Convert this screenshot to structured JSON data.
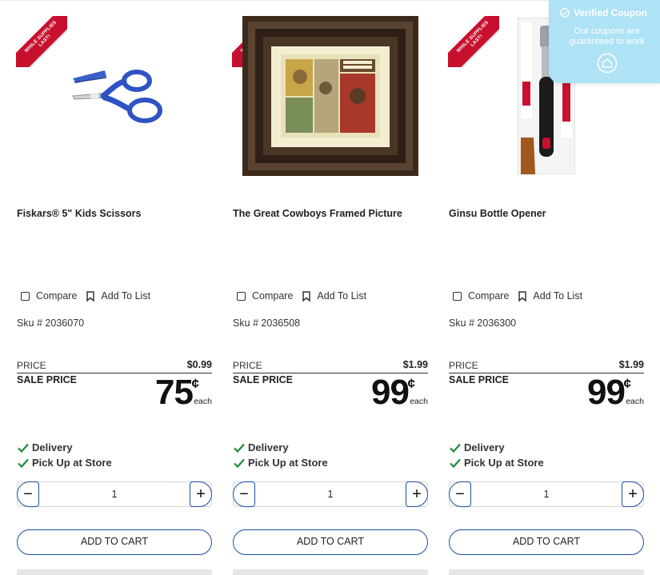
{
  "ribbon": {
    "line1": "WHILE SUPPLIES",
    "line2": "LAST!"
  },
  "products": [
    {
      "name": "Fiskars® 5\" Kids Scissors",
      "sku": "Sku # 2036070",
      "price_label": "PRICE",
      "price": "$0.99",
      "sale_label": "SALE PRICE",
      "sale_amount": "75",
      "sale_unit": "¢",
      "sale_each": "each"
    },
    {
      "name": "The Great Cowboys Framed Picture",
      "sku": "Sku # 2036508",
      "price_label": "PRICE",
      "price": "$1.99",
      "sale_label": "SALE PRICE",
      "sale_amount": "99",
      "sale_unit": "¢",
      "sale_each": "each"
    },
    {
      "name": "Ginsu Bottle Opener",
      "sku": "Sku # 2036300",
      "price_label": "PRICE",
      "price": "$1.99",
      "sale_label": "SALE PRICE",
      "sale_amount": "99",
      "sale_unit": "¢",
      "sale_each": "each"
    }
  ],
  "labels": {
    "compare": "Compare",
    "add_to_list": "Add To List",
    "delivery": "Delivery",
    "pickup": "Pick Up at Store",
    "quantity": "1",
    "minus": "−",
    "plus": "+",
    "add_to_cart": "ADD TO CART"
  },
  "coupon": {
    "title": "Verified Coupon",
    "subtitle_line1": "Our coupons are",
    "subtitle_line2": "guaranteed to work"
  },
  "colors": {
    "accent": "#1a4ea8",
    "check": "#1e8a3c",
    "ribbon": "#c8102e",
    "coupon_bg": "#aee2f5"
  },
  "icons": {
    "ribbon": "while-supplies-last-ribbon",
    "compare": "checkbox-icon",
    "list": "bookmark-icon",
    "available": "checkmark-icon",
    "coupon_badge": "verified-badge-icon",
    "coupon_logo": "coupon-logo-icon"
  }
}
